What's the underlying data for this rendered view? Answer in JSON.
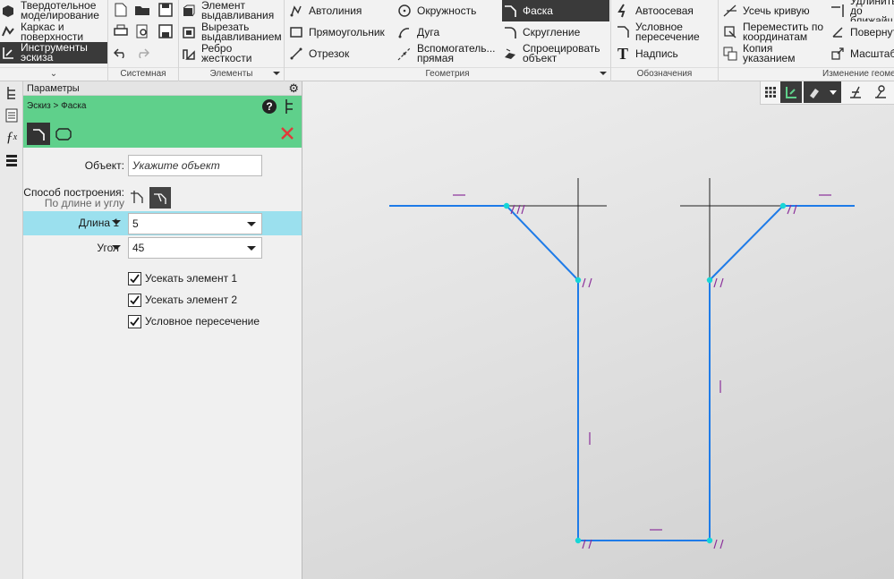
{
  "ribbon": {
    "modes": [
      {
        "label": "Твердотельное моделирование",
        "icon": "solid-icon"
      },
      {
        "label": "Каркас и поверхности",
        "icon": "surface-icon"
      },
      {
        "label": "Инструменты эскиза",
        "icon": "sketch-tools-icon"
      }
    ],
    "groups": {
      "system": "Системная",
      "elements": "Элементы",
      "geometry": "Геометрия",
      "annotation": "Обозначения",
      "edit": "Изменение геометрии"
    },
    "elements": [
      {
        "label": "Элемент выдавливания",
        "icon": "extrude-icon"
      },
      {
        "label": "Вырезать выдавливанием",
        "icon": "cut-extrude-icon"
      },
      {
        "label": "Ребро жесткости",
        "icon": "rib-icon"
      }
    ],
    "geometry": [
      {
        "label": "Автолиния",
        "icon": "autoline-icon"
      },
      {
        "label": "Прямоугольник",
        "icon": "rectangle-icon"
      },
      {
        "label": "Отрезок",
        "icon": "segment-icon"
      },
      {
        "label": "Окружность",
        "icon": "circle-icon"
      },
      {
        "label": "Дуга",
        "icon": "arc-icon"
      },
      {
        "label": "Вспомогатель... прямая",
        "icon": "aux-line-icon"
      },
      {
        "label": "Фаска",
        "icon": "chamfer-icon"
      },
      {
        "label": "Скругление",
        "icon": "fillet-icon"
      },
      {
        "label": "Спроецировать объект",
        "icon": "project-icon"
      }
    ],
    "annotation": [
      {
        "label": "Автоосевая",
        "icon": "auto-axis-icon"
      },
      {
        "label": "Условное пересечение",
        "icon": "cond-intersection-icon"
      },
      {
        "label": "Надпись",
        "icon": "text-icon"
      }
    ],
    "edit": [
      {
        "label": "Усечь кривую",
        "icon": "trim-icon"
      },
      {
        "label": "Переместить по координатам",
        "icon": "move-coords-icon"
      },
      {
        "label": "Копия указанием",
        "icon": "copy-icon"
      },
      {
        "label": "Удлинить до ближайш",
        "icon": "extend-icon"
      },
      {
        "label": "Повернут",
        "icon": "rotate-icon"
      },
      {
        "label": "Масштаб",
        "icon": "scale-icon"
      }
    ]
  },
  "panel": {
    "title": "Параметры",
    "breadcrumb": "Эскиз > Фаска",
    "object_label": "Объект:",
    "object_placeholder": "Укажите объект",
    "method_label": "Способ построения:",
    "method_value": "По длине и углу",
    "length_label": "Длина 1",
    "length_value": "5",
    "angle_label": "Угол",
    "angle_value": "45",
    "checkboxes": [
      {
        "label": "Усекать элемент 1",
        "checked": true
      },
      {
        "label": "Усекать элемент 2",
        "checked": true
      },
      {
        "label": "Условное пересечение",
        "checked": true
      }
    ]
  },
  "colors": {
    "accent_green": "#5fd08b",
    "highlight_row": "#9be0ee",
    "sketch_line": "#1e7be8",
    "point": "#16d6d6",
    "constraint": "#8a2f9a"
  }
}
